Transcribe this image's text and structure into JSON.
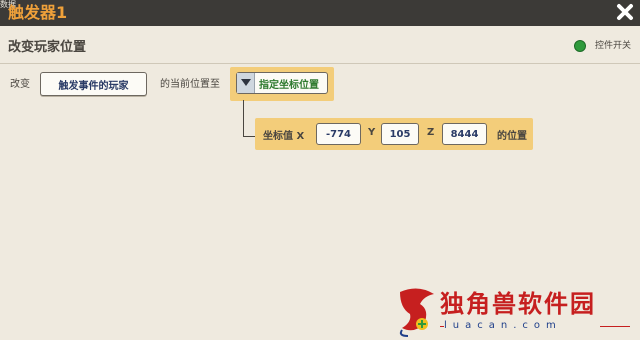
{
  "window": {
    "sys_label": "数据",
    "title": "触发器1",
    "close_icon": "close-x-icon"
  },
  "section": {
    "title": "改变玩家位置",
    "toggle_label": "控件开关",
    "toggle_color": "#2f9a3c"
  },
  "row": {
    "prefix": "改变",
    "target_button": "触发事件的玩家",
    "middle_text": "的当前位置至",
    "dropdown_label": "指定坐标位置",
    "dropdown_icon": "triangle-down-icon"
  },
  "coords": {
    "label": "坐标值 X",
    "x_value": "-774",
    "y_label": "Y",
    "y_value": "105",
    "z_label": "Z",
    "z_value": "8444",
    "suffix": "的位置"
  },
  "watermark": {
    "text": "独角兽软件园",
    "url": "luacan.com",
    "logo": "unicorn-logo-icon"
  },
  "colors": {
    "accent_orange": "#f0a13a",
    "highlight_yellow": "#f3cd7a",
    "dropdown_green": "#2f7a2f"
  }
}
